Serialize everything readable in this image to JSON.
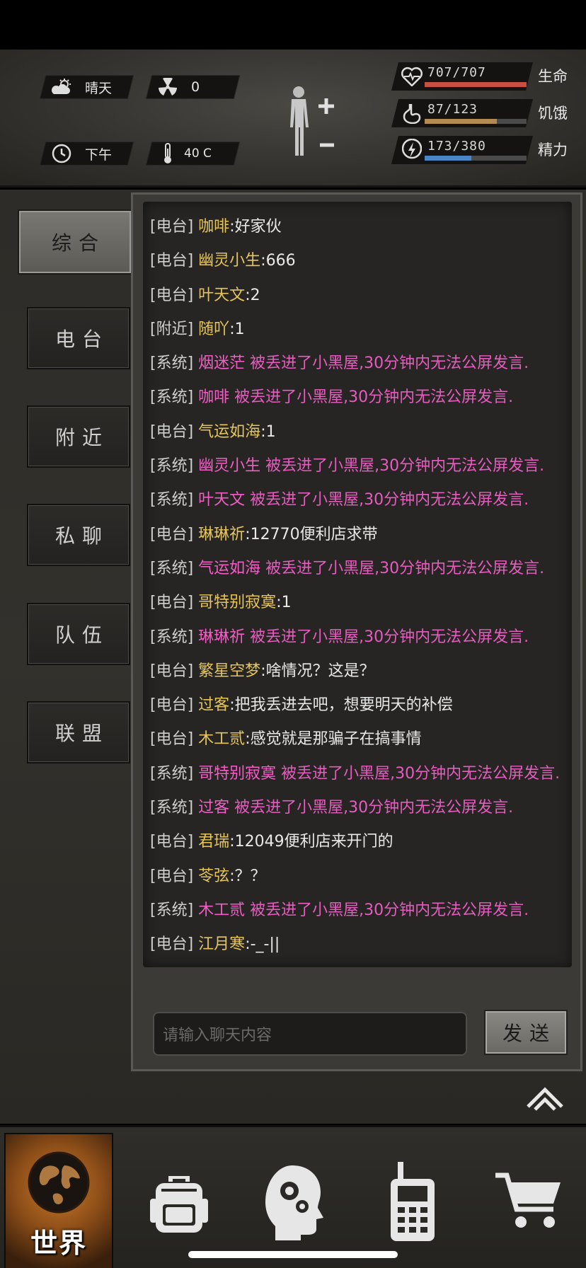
{
  "status": {
    "weather": {
      "icon": "partly-cloudy-icon",
      "label": "晴天"
    },
    "radiation": {
      "icon": "radiation-icon",
      "value": "0"
    },
    "time": {
      "icon": "clock-icon",
      "label": "下午"
    },
    "temperature": {
      "icon": "thermometer-icon",
      "value": "40 C"
    }
  },
  "vitals": [
    {
      "id": "health",
      "icon": "heart-pulse-icon",
      "value": "707/707",
      "label": "生命",
      "current": 707,
      "max": 707,
      "color": "#c85040"
    },
    {
      "id": "hunger",
      "icon": "stomach-icon",
      "value": "87/123",
      "label": "饥饿",
      "current": 87,
      "max": 123,
      "color": "#b38a52"
    },
    {
      "id": "energy",
      "icon": "energy-bolt-icon",
      "value": "173/380",
      "label": "精力",
      "current": 173,
      "max": 380,
      "color": "#4a86c6"
    }
  ],
  "tabs": [
    {
      "id": "all",
      "label": "综合",
      "active": true
    },
    {
      "id": "radio",
      "label": "电台",
      "active": false
    },
    {
      "id": "nearby",
      "label": "附近",
      "active": false
    },
    {
      "id": "private",
      "label": "私聊",
      "active": false
    },
    {
      "id": "team",
      "label": "队伍",
      "active": false
    },
    {
      "id": "alliance",
      "label": "联盟",
      "active": false
    }
  ],
  "messages": [
    {
      "channel": "[电台]",
      "name": "咖啡",
      "text": ":好家伙",
      "system": false
    },
    {
      "channel": "[电台]",
      "name": "幽灵小生",
      "text": ":666",
      "system": false
    },
    {
      "channel": "[电台]",
      "name": "叶天文",
      "text": ":2",
      "system": false
    },
    {
      "channel": "[附近]",
      "name": "随吖",
      "text": ":1",
      "system": false
    },
    {
      "channel": "[系统]",
      "name": "烟迷茫",
      "text": " 被丢进了小黑屋,30分钟内无法公屏发言.",
      "system": true
    },
    {
      "channel": "[系统]",
      "name": "咖啡",
      "text": " 被丢进了小黑屋,30分钟内无法公屏发言.",
      "system": true
    },
    {
      "channel": "[电台]",
      "name": "气运如海",
      "text": ":1",
      "system": false
    },
    {
      "channel": "[系统]",
      "name": "幽灵小生",
      "text": " 被丢进了小黑屋,30分钟内无法公屏发言.",
      "system": true
    },
    {
      "channel": "[系统]",
      "name": "叶天文",
      "text": " 被丢进了小黑屋,30分钟内无法公屏发言.",
      "system": true
    },
    {
      "channel": "[电台]",
      "name": "琳琳祈",
      "text": ":12770便利店求带",
      "system": false
    },
    {
      "channel": "[系统]",
      "name": "气运如海",
      "text": " 被丢进了小黑屋,30分钟内无法公屏发言.",
      "system": true
    },
    {
      "channel": "[电台]",
      "name": "哥特别寂寞",
      "text": ":1",
      "system": false
    },
    {
      "channel": "[系统]",
      "name": "琳琳祈",
      "text": " 被丢进了小黑屋,30分钟内无法公屏发言.",
      "system": true
    },
    {
      "channel": "[电台]",
      "name": "繁星空梦",
      "text": ":啥情况？这是？",
      "system": false
    },
    {
      "channel": "[电台]",
      "name": "过客",
      "text": ":把我丢进去吧，想要明天的补偿",
      "system": false
    },
    {
      "channel": "[电台]",
      "name": "木工贰",
      "text": ":感觉就是那骗子在搞事情",
      "system": false
    },
    {
      "channel": "[系统]",
      "name": "哥特别寂寞",
      "text": " 被丢进了小黑屋,30分钟内无法公屏发言.",
      "system": true
    },
    {
      "channel": "[系统]",
      "name": "过客",
      "text": " 被丢进了小黑屋,30分钟内无法公屏发言.",
      "system": true
    },
    {
      "channel": "[电台]",
      "name": "君瑞",
      "text": ":12049便利店来开门的",
      "system": false
    },
    {
      "channel": "[电台]",
      "name": "苓弦",
      "text": ":？？",
      "system": false
    },
    {
      "channel": "[系统]",
      "name": "木工贰",
      "text": " 被丢进了小黑屋,30分钟内无法公屏发言.",
      "system": true
    },
    {
      "channel": "[电台]",
      "name": "江月寒",
      "text": ":-_-||",
      "system": false
    }
  ],
  "input": {
    "placeholder": "请输入聊天内容"
  },
  "send_label": "发送",
  "nav": [
    {
      "id": "world",
      "label": "世界",
      "icon": "globe-icon",
      "active": true
    },
    {
      "id": "backpack",
      "label": "",
      "icon": "backpack-icon",
      "active": false
    },
    {
      "id": "skills",
      "label": "",
      "icon": "head-gears-icon",
      "active": false
    },
    {
      "id": "radio",
      "label": "",
      "icon": "walkie-talkie-icon",
      "active": false
    },
    {
      "id": "shop",
      "label": "",
      "icon": "shopping-cart-icon",
      "active": false
    }
  ]
}
